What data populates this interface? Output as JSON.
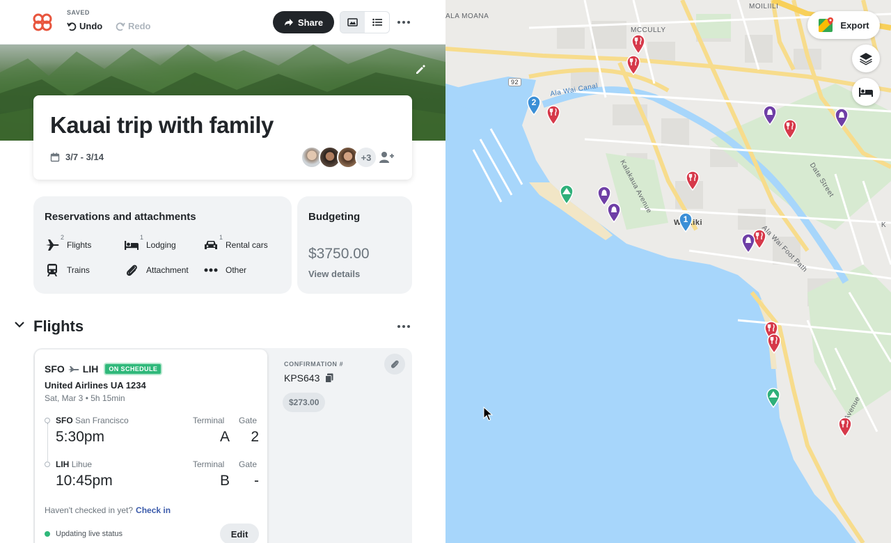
{
  "header": {
    "saved_label": "SAVED",
    "undo_label": "Undo",
    "redo_label": "Redo",
    "share_label": "Share"
  },
  "trip": {
    "title": "Kauai trip with family",
    "dates": "3/7 - 3/14",
    "extra_members": "+3"
  },
  "reservations": {
    "title": "Reservations and attachments",
    "items": [
      {
        "label": "Flights",
        "count": "2",
        "icon": "plane-icon"
      },
      {
        "label": "Lodging",
        "count": "1",
        "icon": "bed-icon"
      },
      {
        "label": "Rental cars",
        "count": "1",
        "icon": "car-icon"
      },
      {
        "label": "Trains",
        "count": "",
        "icon": "train-icon"
      },
      {
        "label": "Attachment",
        "count": "",
        "icon": "paperclip-icon"
      },
      {
        "label": "Other",
        "count": "",
        "icon": "dots-icon"
      }
    ]
  },
  "budget": {
    "title": "Budgeting",
    "amount": "$3750.00",
    "link": "View details"
  },
  "flights_section": {
    "title": "Flights",
    "flight": {
      "from_code": "SFO",
      "to_code": "LIH",
      "status": "ON SCHEDULE",
      "airline": "United Airlines UA 1234",
      "date_duration": "Sat, Mar 3 • 5h 15min",
      "terminal_label": "Terminal",
      "gate_label": "Gate",
      "departure": {
        "code": "SFO",
        "city": "San Francisco",
        "time": "5:30pm",
        "terminal": "A",
        "gate": "2"
      },
      "arrival": {
        "code": "LIH",
        "city": "Lihue",
        "time": "10:45pm",
        "terminal": "B",
        "gate": "-"
      },
      "checkin_question": "Haven't checked in yet?",
      "checkin_link": "Check in",
      "live_status": "Updating live status",
      "edit_label": "Edit",
      "confirmation_label": "CONFIRMATION #",
      "confirmation_value": "KPS643",
      "price": "$273.00"
    }
  },
  "map": {
    "export_label": "Export",
    "labels": {
      "ala_moana": "ALA MOANA",
      "mccully": "MCCULLY",
      "moiliili": "MOILIILI",
      "route_92": "92",
      "canal": "Ala Wai Canal",
      "kalakaua": "Kalakaua Avenue",
      "date_street": "Date Street",
      "foot_path": "Ala Wai Foot Path",
      "waikiki": "Waikiki",
      "kapahulu": "ki Avenue",
      "cut_k": "K"
    },
    "pin_numbers": {
      "blue_two": "2",
      "blue_one": "1"
    },
    "colors": {
      "restaurant": "#d6394a",
      "attraction": "#6f3fa6",
      "lodging": "#3b8fd6",
      "park": "#2fb07a",
      "water": "#a7d6fb"
    }
  }
}
